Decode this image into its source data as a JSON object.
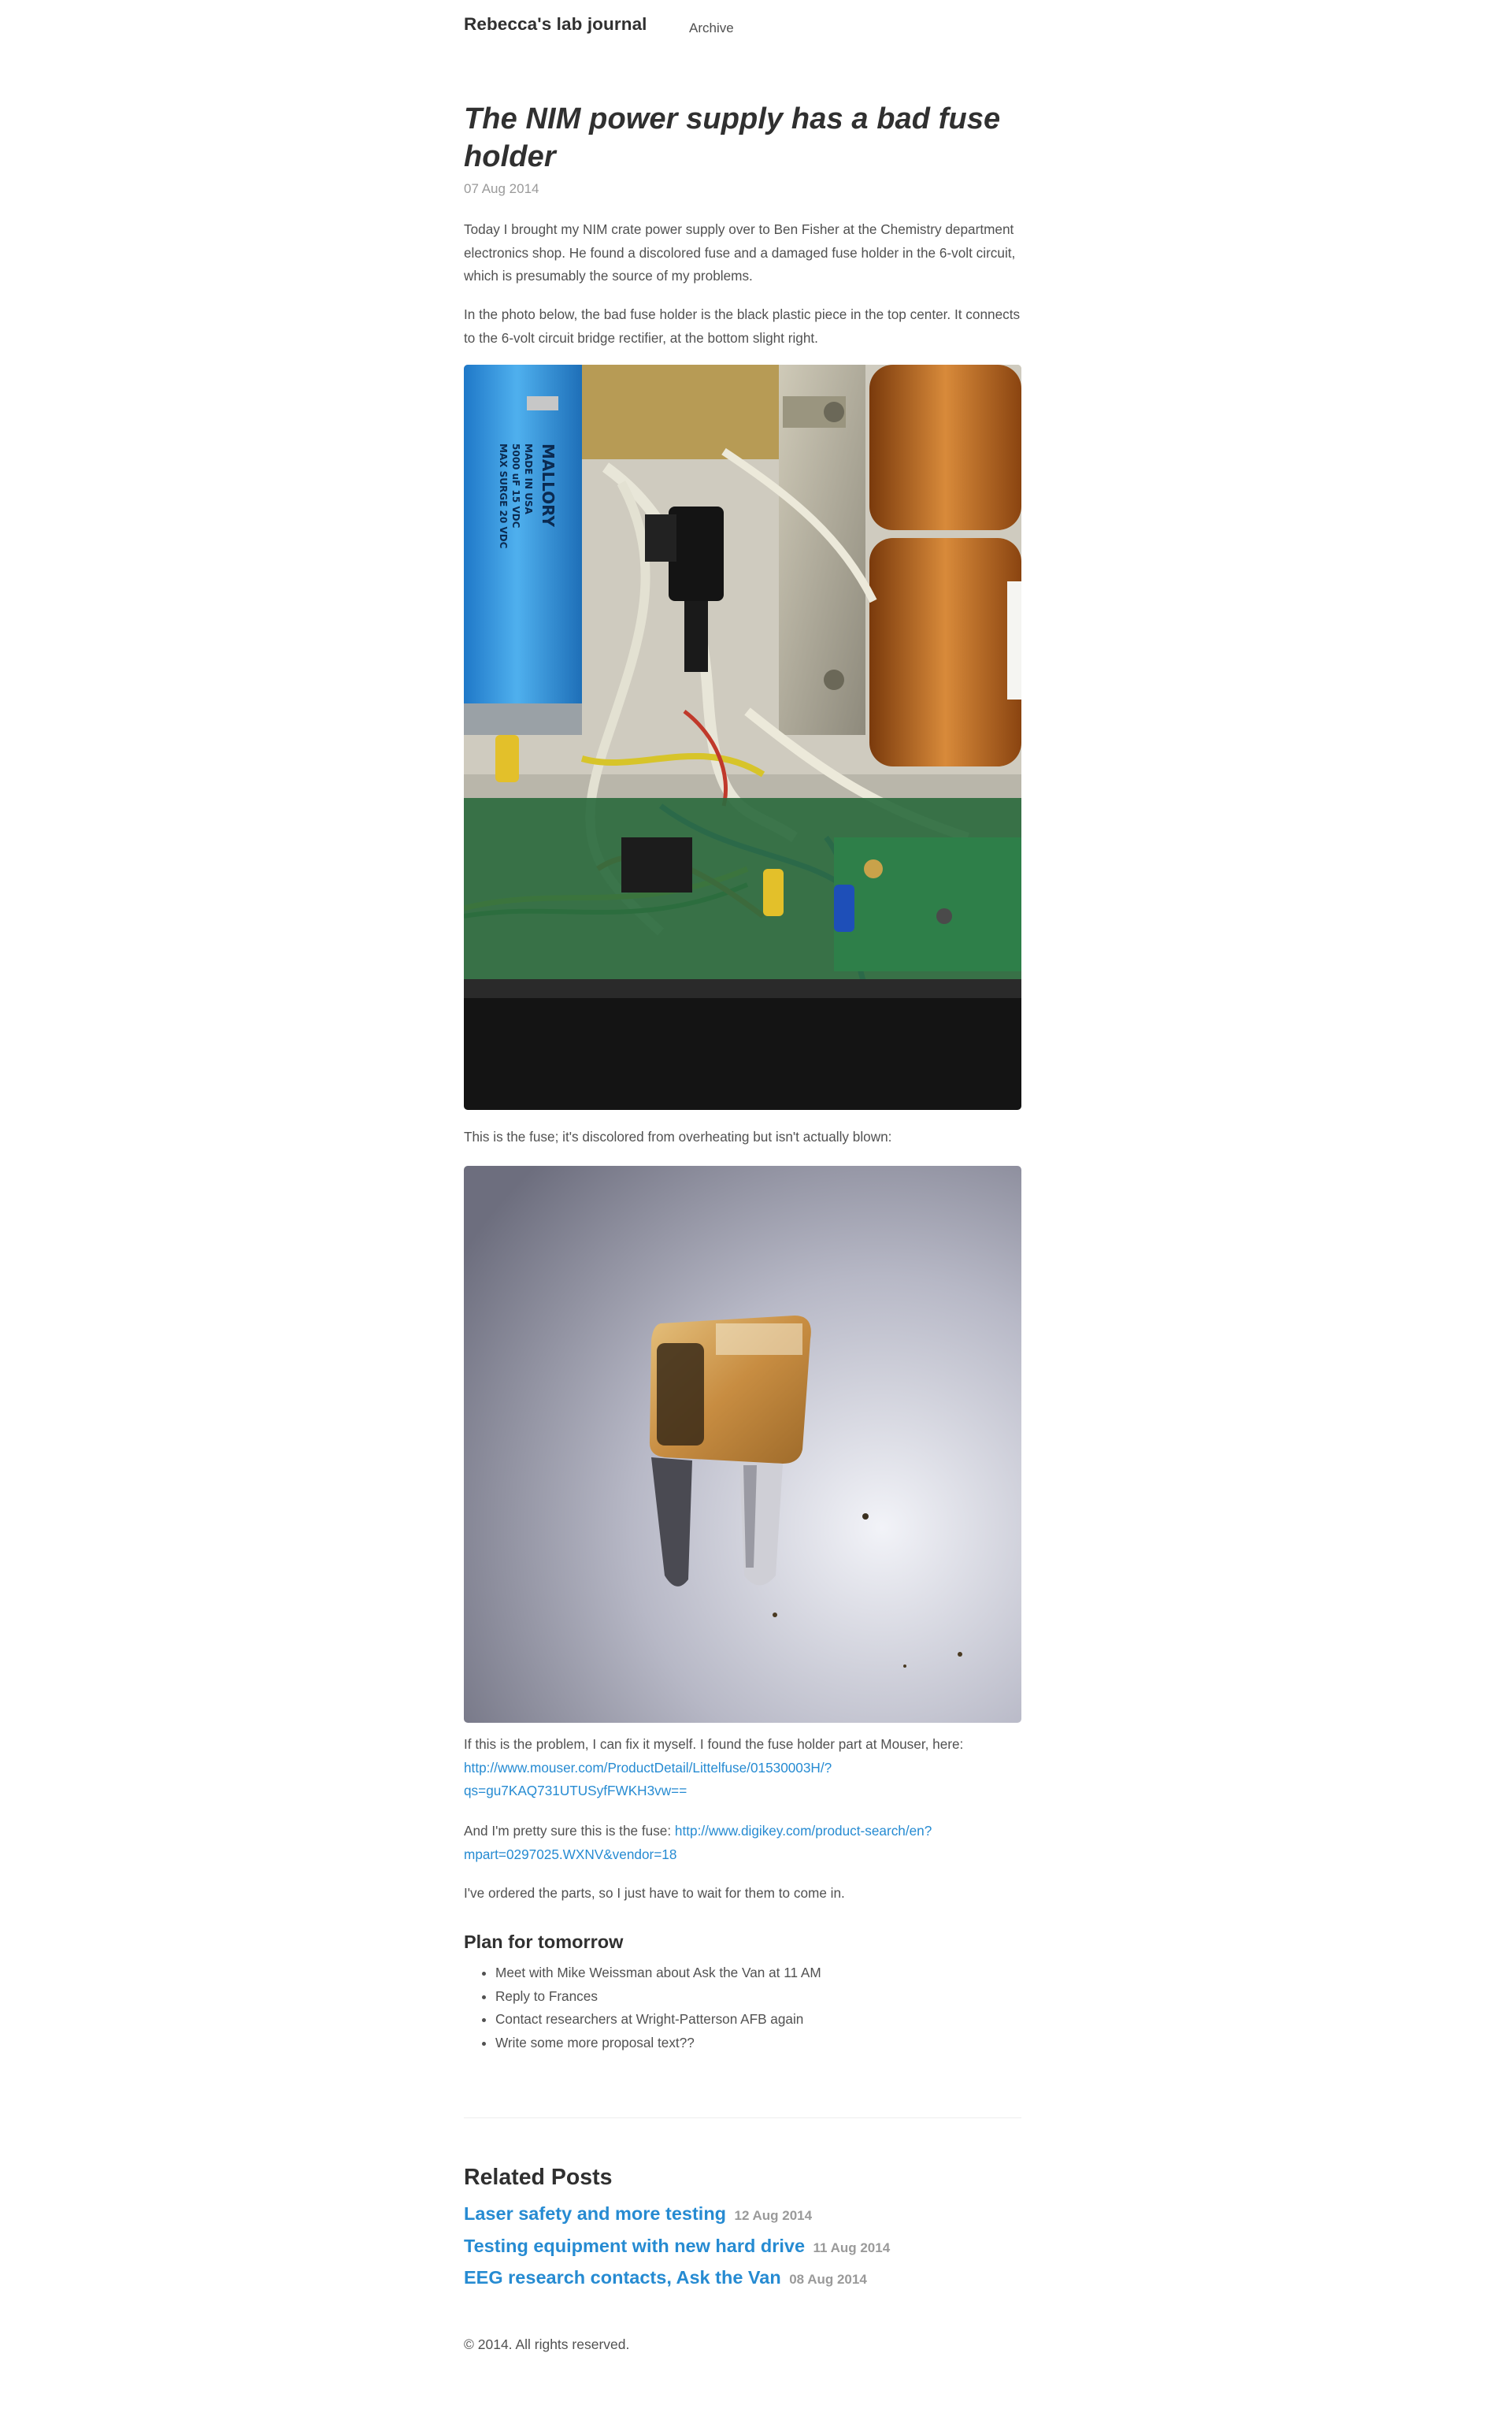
{
  "site": {
    "title": "Rebecca's lab journal",
    "nav": {
      "archive": "Archive"
    }
  },
  "post": {
    "title": "The NIM power supply has a bad fuse holder",
    "date": "07 Aug 2014",
    "p1": "Today I brought my NIM crate power supply over to Ben Fisher at the Chemistry department electronics shop. He found a discolored fuse and a damaged fuse holder in the 6-volt circuit, which is presumably the source of my problems.",
    "p2": "In the photo below, the bad fuse holder is the black plastic piece in the top center. It connects to the 6-volt circuit bridge rectifier, at the bottom slight right.",
    "photo1_text": {
      "brand": "MALLORY",
      "made": "MADE IN USA",
      "rating": "5000 uF 15 VDC",
      "surge": "MAX SURGE 20 VDC"
    },
    "p3": "This is the fuse; it's discolored from overheating but isn't actually blown:",
    "p4_text": "If this is the problem, I can fix it myself. I found the fuse holder part at Mouser, here:",
    "p4_link": "http://www.mouser.com/ProductDetail/Littelfuse/01530003H/?qs=gu7KAQ731UTUSyfFWKH3vw==",
    "p5_text": "And I'm pretty sure this is the fuse:",
    "p5_link": "http://www.digikey.com/product-search/en?mpart=0297025.WXNV&vendor=18",
    "p6": "I've ordered the parts, so I just have to wait for them to come in.",
    "plan_heading": "Plan for tomorrow",
    "plan": [
      "Meet with Mike Weissman about Ask the Van at 11 AM",
      "Reply to Frances",
      "Contact researchers at Wright-Patterson AFB again",
      "Write some more proposal text??"
    ]
  },
  "related": {
    "heading": "Related Posts",
    "items": [
      {
        "title": "Laser safety and more testing",
        "date": "12 Aug 2014"
      },
      {
        "title": "Testing equipment with new hard drive",
        "date": "11 Aug 2014"
      },
      {
        "title": "EEG research contacts, Ask the Van",
        "date": "08 Aug 2014"
      }
    ]
  },
  "footer": {
    "text": "© 2014. All rights reserved."
  },
  "colors": {
    "link": "#268bd2",
    "heading": "#303030",
    "body": "#515151",
    "muted": "#9a9a9a"
  }
}
